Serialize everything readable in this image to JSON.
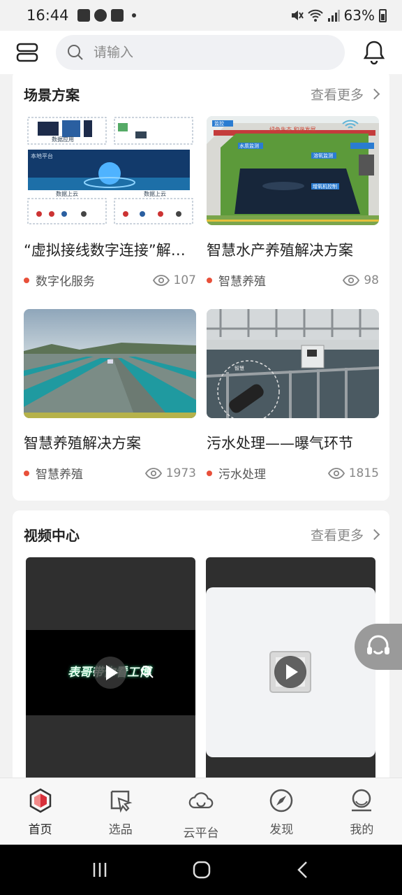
{
  "status_bar": {
    "time": "16:44",
    "battery": "63%"
  },
  "search": {
    "placeholder": "请输入"
  },
  "scene_section": {
    "title": "场景方案",
    "more": "查看更多",
    "items": [
      {
        "name": "“虚拟接线数字连接”解决方案",
        "tag": "数字化服务",
        "views": "107"
      },
      {
        "name": "智慧水产养殖解决方案",
        "tag": "智慧养殖",
        "views": "98"
      },
      {
        "name": "智慧养殖解决方案",
        "tag": "智慧养殖",
        "views": "1973"
      },
      {
        "name": "污水处理——曝气环节",
        "tag": "污水处理",
        "views": "1815"
      }
    ],
    "thumb_labels": {
      "t1_a": "数据应用",
      "t1_b": "本地平台",
      "t1_c": "数据上云",
      "t1_d": "数据上云",
      "t2_a": "绿色生态  和谐发展",
      "t2_b": "水质监测",
      "t2_c": "溶氧监测",
      "t2_d": "增氧机控制",
      "t2_e": "监控",
      "t4_a": "智慧"
    }
  },
  "video_section": {
    "title": "视频中心",
    "more": "查看更多",
    "videos": [
      {
        "caption": "表哥带你看工博"
      },
      {
        "caption": ""
      }
    ]
  },
  "tabs": [
    {
      "label": "首页",
      "icon": "home-icon",
      "active": true
    },
    {
      "label": "选品",
      "icon": "cursor-select-icon",
      "active": false
    },
    {
      "label": "云平台",
      "icon": "cloud-icon",
      "active": false
    },
    {
      "label": "发现",
      "icon": "compass-icon",
      "active": false
    },
    {
      "label": "我的",
      "icon": "user-icon",
      "active": false
    }
  ],
  "colors": {
    "accent": "#e8503a",
    "brand_red": "#d7303b"
  }
}
